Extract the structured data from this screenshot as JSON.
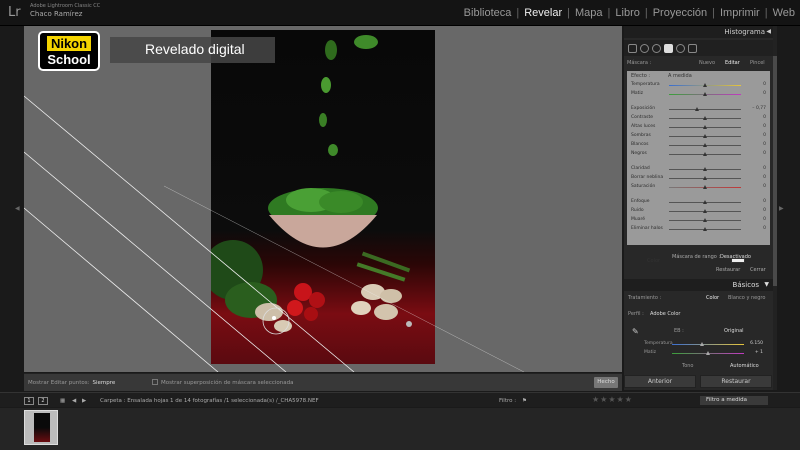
{
  "topbar": {
    "logo": "Lr",
    "app_name": "Adobe Lightroom Classic CC",
    "user_name": "Chaco Ramírez",
    "modules": [
      "Biblioteca",
      "Revelar",
      "Mapa",
      "Libro",
      "Proyección",
      "Imprimir",
      "Web"
    ],
    "active_module": "Revelar"
  },
  "overlay": {
    "logo_line1": "Nikon",
    "logo_line2": "School",
    "banner": "Revelado digital"
  },
  "canvas_toolbar": {
    "show_edit_points_label": "Mostrar Editar puntos:",
    "show_edit_points_value": "Siempre",
    "show_mask_overlay_label": "Mostrar superposición de máscara seleccionada",
    "done_label": "Hecho"
  },
  "right_panel": {
    "histogram_title": "Histograma",
    "mask": {
      "label": "Máscara :",
      "options": [
        "Nuevo",
        "Editar",
        "Pincel"
      ],
      "active": "Editar"
    },
    "effect": {
      "label": "Efecto :",
      "value": "A medida"
    },
    "sliders": [
      {
        "label": "Temperatura",
        "value": "0",
        "pos": 0.5
      },
      {
        "label": "Matiz",
        "value": "0",
        "pos": 0.5
      },
      {
        "label": "Exposición",
        "value": "– 0,77",
        "pos": 0.4
      },
      {
        "label": "Contraste",
        "value": "0",
        "pos": 0.5
      },
      {
        "label": "Altas luces",
        "value": "0",
        "pos": 0.5
      },
      {
        "label": "Sombras",
        "value": "0",
        "pos": 0.5
      },
      {
        "label": "Blancos",
        "value": "0",
        "pos": 0.5
      },
      {
        "label": "Negros",
        "value": "0",
        "pos": 0.5
      },
      {
        "label": "Claridad",
        "value": "0",
        "pos": 0.5
      },
      {
        "label": "Borrar neblina",
        "value": "0",
        "pos": 0.5
      },
      {
        "label": "Saturación",
        "value": "0",
        "pos": 0.5
      },
      {
        "label": "Enfoque",
        "value": "0",
        "pos": 0.5
      },
      {
        "label": "Ruido",
        "value": "0",
        "pos": 0.5
      },
      {
        "label": "Muaré",
        "value": "0",
        "pos": 0.5
      },
      {
        "label": "Eliminar halos",
        "value": "0",
        "pos": 0.5
      }
    ],
    "color_label": "Color",
    "range_mask_label": "Máscara de rango :",
    "range_mask_value": "Desactivado",
    "restore_label": "Restaurar",
    "close_label": "Cerrar",
    "basics_title": "Básicos",
    "treatment_label": "Tratamiento :",
    "treatment_options": [
      "Color",
      "Blanco y negro"
    ],
    "profile_label": "Perfil :",
    "profile_value": "Adobe Color",
    "wb_label": "EB :",
    "wb_value": "Original",
    "temperature_label": "Temperatura",
    "temperature_value": "6.150",
    "temperature_pos": 0.42,
    "tint_label": "Matiz",
    "tint_value": "+ 1",
    "tint_pos": 0.5,
    "tone_label": "Tono",
    "tone_auto": "Automático",
    "prev_button": "Anterior",
    "reset_button": "Restaurar"
  },
  "filmstrip_bar": {
    "page1": "1",
    "page2": "2",
    "folder_info": "Carpeta : Ensalada hojas",
    "count_info": "1 de 14 fotografías /1 seleccionada(s) /_CHA5978.NEF",
    "filter_label": "Filtro :",
    "filter_value": "Filtro a medida"
  },
  "colors": {
    "accent_active": "#eeeeee",
    "panel_bg": "#282828",
    "canvas_bg": "#686868"
  }
}
